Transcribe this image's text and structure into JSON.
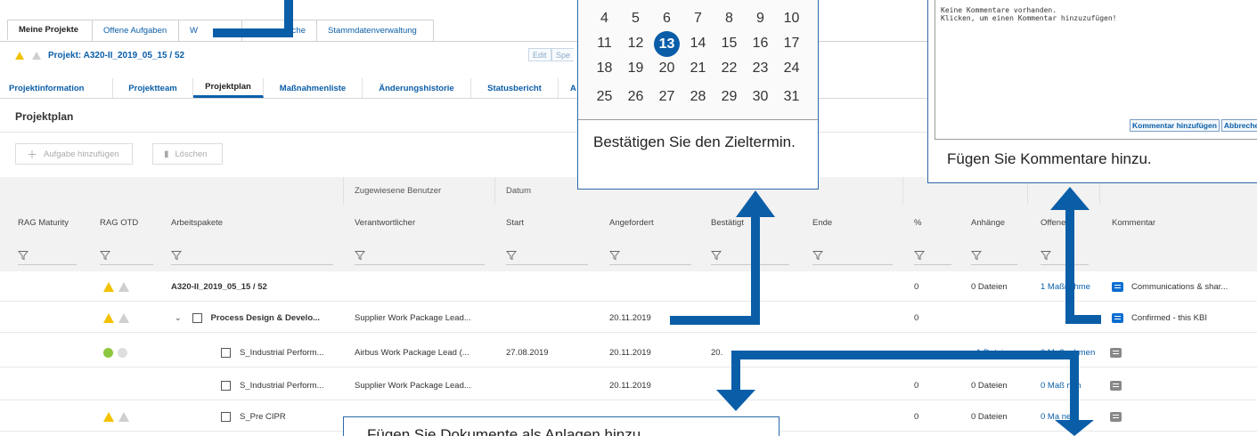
{
  "top_tabs": [
    {
      "label": "Meine Projekte",
      "active": true
    },
    {
      "label": "Offene Aufgaben",
      "active": false
    },
    {
      "label": "W",
      "active": false
    },
    {
      "label": "che",
      "active": false
    },
    {
      "label": "Stammdatenverwaltung",
      "active": false
    }
  ],
  "project": {
    "title": "Projekt: A320-II_2019_05_15 / 52",
    "edit_label": "Edit",
    "spec_label": "Spe"
  },
  "sub_tabs": [
    {
      "label": "Projektinformation",
      "active": false
    },
    {
      "label": "Projektteam",
      "active": false
    },
    {
      "label": "Projektplan",
      "active": true
    },
    {
      "label": "Maßnahmenliste",
      "active": false
    },
    {
      "label": "Änderungshistorie",
      "active": false
    },
    {
      "label": "Statusbericht",
      "active": false
    },
    {
      "label": "A",
      "active": false
    }
  ],
  "section_title": "Projektplan",
  "toolbar": {
    "add_label": "Aufgabe hinzufügen",
    "delete_label": "Löschen"
  },
  "table": {
    "group_headers": {
      "assigned_users": "Zugewiesene Benutzer",
      "date": "Datum"
    },
    "columns": {
      "rag_maturity": "RAG Maturity",
      "rag_otd": "RAG OTD",
      "work_packages": "Arbeitspakete",
      "responsible": "Verantwortlicher",
      "start": "Start",
      "requested": "Angefordert",
      "confirmed": "Bestätigt",
      "end": "Ende",
      "percent": "%",
      "attachments": "Anhänge",
      "open_actions": "Offene ...",
      "comment": "Kommentar"
    },
    "rows": [
      {
        "rag": "yellow",
        "name": "A320-II_2019_05_15 / 52",
        "bold": true,
        "responsible": "",
        "start": "",
        "requested": "",
        "confirmed": "",
        "percent": "0",
        "attachments": "0 Dateien",
        "actions": "1 Maßnahme",
        "comment": "Communications & shar...",
        "comment_active": true
      },
      {
        "rag": "yellow",
        "name": "Process Design & Develo...",
        "bold": true,
        "chevron": "⌄",
        "checkbox": true,
        "responsible": "Supplier Work Package Lead...",
        "start": "",
        "requested": "20.11.2019",
        "confirmed": "",
        "percent": "0",
        "attachments": "",
        "actions": "",
        "comment": "Confirmed - this KBI",
        "comment_active": true
      },
      {
        "rag": "green",
        "name": "S_Industrial Perform...",
        "bold": false,
        "checkbox": true,
        "responsible": "Airbus Work Package Lead (...",
        "start": "27.08.2019",
        "requested": "20.11.2019",
        "confirmed": "20.",
        "percent": "",
        "attachments": "1 Datei",
        "actions": "0 Maßnahmen",
        "comment": "",
        "comment_active": false
      },
      {
        "rag": "",
        "name": "S_Industrial Perform...",
        "bold": false,
        "checkbox": true,
        "responsible": "Supplier Work Package Lead...",
        "start": "",
        "requested": "20.11.2019",
        "confirmed": "",
        "percent": "0",
        "attachments": "0 Dateien",
        "actions": "0 Maß  nen",
        "comment": "",
        "comment_active": false
      },
      {
        "rag": "yellow",
        "name": "S_Pre CIPR",
        "bold": false,
        "checkbox": true,
        "responsible": "",
        "start": "",
        "requested": "",
        "confirmed": "",
        "percent": "0",
        "attachments": "0 Dateien",
        "actions": "0 Ma  nen",
        "comment": "",
        "comment_active": false
      }
    ]
  },
  "calendar": {
    "weeks": [
      [
        "4",
        "5",
        "6",
        "7",
        "8",
        "9",
        "10"
      ],
      [
        "11",
        "12",
        "13",
        "14",
        "15",
        "16",
        "17"
      ],
      [
        "18",
        "19",
        "20",
        "21",
        "22",
        "23",
        "24"
      ],
      [
        "25",
        "26",
        "27",
        "28",
        "29",
        "30",
        "31"
      ]
    ],
    "selected": "13",
    "note": "Bestätigen Sie den Zieltermin."
  },
  "comment_popup": {
    "text_line1": "Keine Kommentare vorhanden.",
    "text_line2": "Klicken, um einen Kommentar hinzuzufügen!",
    "add_button": "Kommentar hinzufügen",
    "cancel_button": "Abbrechen",
    "note": "Fügen Sie Kommentare hinzu."
  },
  "doc_popup": {
    "note": "Fügen Sie Dokumente als Anlagen hinzu."
  },
  "colors": {
    "accent": "#0a5ea8",
    "warning": "#f2c200",
    "ok": "#8dc63f"
  }
}
